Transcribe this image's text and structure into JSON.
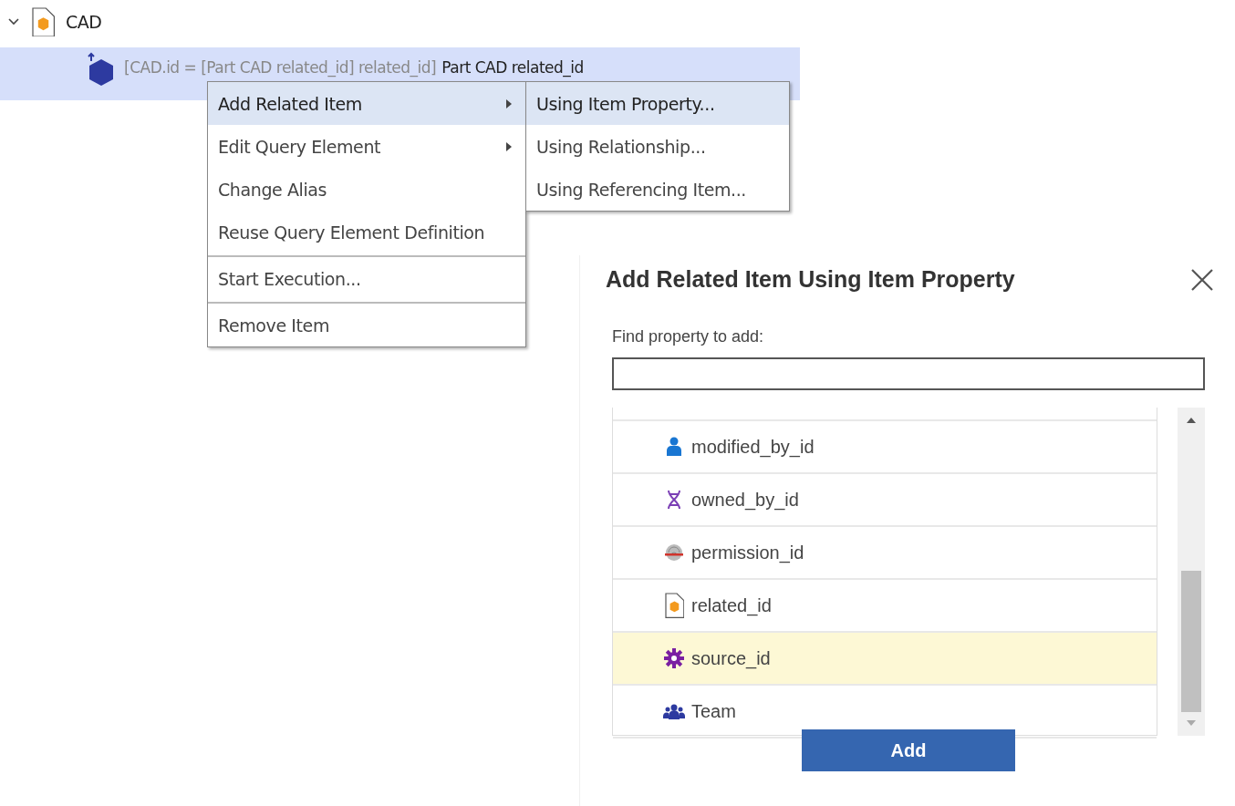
{
  "tree": [
    {
      "label": "CAD",
      "kind": "document",
      "expanded": true,
      "selected": false,
      "children": [
        {
          "label_gray": "[CAD.id = [Part CAD related_id] related_id]",
          "label": "Part CAD related_id",
          "kind": "hexagon",
          "selected": true
        }
      ]
    }
  ],
  "context_menu": {
    "items": [
      {
        "label": "Add Related Item",
        "submenu": true,
        "selected": true,
        "separator_before": false
      },
      {
        "label": "Edit Query Element",
        "submenu": true,
        "selected": false,
        "separator_before": false
      },
      {
        "label": "Change Alias",
        "submenu": false,
        "selected": false,
        "separator_before": false
      },
      {
        "label": "Reuse Query Element Definition",
        "submenu": false,
        "selected": false,
        "separator_before": false
      },
      {
        "label": "Start Execution...",
        "submenu": false,
        "selected": false,
        "separator_before": true
      },
      {
        "label": "Remove Item",
        "submenu": false,
        "selected": false,
        "separator_before": true
      }
    ],
    "submenu": [
      {
        "label": "Using Item Property...",
        "selected": true
      },
      {
        "label": "Using Relationship...",
        "selected": false
      },
      {
        "label": "Using Referencing Item...",
        "selected": false
      }
    ]
  },
  "dialog": {
    "title": "Add Related Item Using Item Property",
    "field_label": "Find property to add:",
    "properties": [
      {
        "label": "modified_by_id",
        "kind": "person",
        "selected": false
      },
      {
        "label": "owned_by_id",
        "kind": "dna",
        "selected": false
      },
      {
        "label": "permission_id",
        "kind": "fingerprint",
        "selected": false
      },
      {
        "label": "related_id",
        "kind": "document",
        "selected": false
      },
      {
        "label": "source_id",
        "kind": "gear",
        "selected": true
      },
      {
        "label": "Team",
        "kind": "team",
        "selected": false
      }
    ],
    "button": "Add"
  }
}
